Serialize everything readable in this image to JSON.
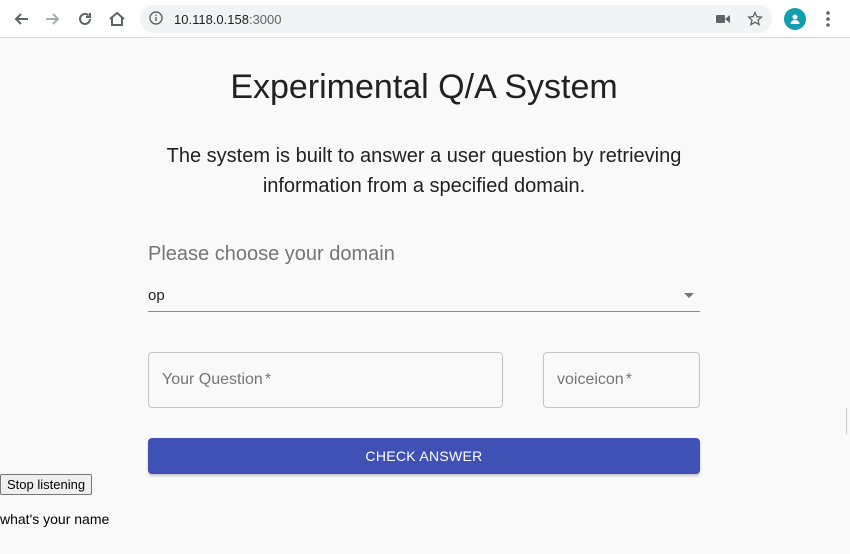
{
  "browser": {
    "url_host": "10.118.0.158",
    "url_port": ":3000",
    "icons": [
      "back-icon",
      "forward-icon",
      "reload-icon",
      "home-icon",
      "info-icon",
      "camera-icon",
      "star-icon",
      "profile-icon",
      "menu-icon"
    ]
  },
  "page": {
    "title": "Experimental Q/A System",
    "description": "The system is built to answer a user question by retrieving information from a specified domain.",
    "domain_label": "Please choose your domain",
    "domain_value": "op",
    "question_placeholder": "Your Question",
    "voice_placeholder": "voiceicon",
    "required_mark": "*",
    "check_button": "CHECK ANSWER",
    "stop_button": "Stop listening",
    "transcript": "what's your name"
  },
  "colors": {
    "accent": "#3f51b5",
    "avatar": "#129eaf",
    "background": "#f9f9f9"
  }
}
